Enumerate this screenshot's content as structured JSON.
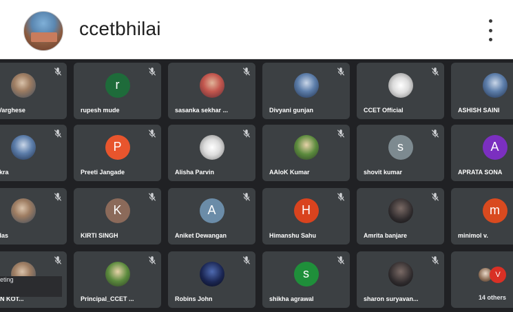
{
  "header": {
    "title": "ccetbhilai"
  },
  "tiles": [
    {
      "name": "P S Varghese",
      "initial": "",
      "color": ""
    },
    {
      "name": "rupesh mude",
      "initial": "r",
      "color": "#1e6b3a"
    },
    {
      "name": "sasanka sekhar ...",
      "initial": "",
      "color": ""
    },
    {
      "name": "Divyani gunjan",
      "initial": "",
      "color": ""
    },
    {
      "name": "CCET Official",
      "initial": "",
      "color": ""
    },
    {
      "name": "ASHISH SAINI",
      "initial": "",
      "color": ""
    },
    {
      "name": "Painkra",
      "initial": "",
      "color": ""
    },
    {
      "name": "Preeti Jangade",
      "initial": "P",
      "color": "#e8552d"
    },
    {
      "name": "Alisha Parvin",
      "initial": "",
      "color": ""
    },
    {
      "name": "AAloK Kumar",
      "initial": "",
      "color": ""
    },
    {
      "name": "shovit kumar",
      "initial": "s",
      "color": "#7d8a90"
    },
    {
      "name": "APRATA SONA",
      "initial": "A",
      "color": "#7b2fc0"
    },
    {
      "name": "Devdas",
      "initial": "",
      "color": ""
    },
    {
      "name": "KIRTI SINGH",
      "initial": "K",
      "color": "#8b6a5a"
    },
    {
      "name": "Aniket Dewangan",
      "initial": "A",
      "color": "#6b8ca8"
    },
    {
      "name": "Himanshu Sahu",
      "initial": "H",
      "color": "#d9431e"
    },
    {
      "name": "Amrita banjare",
      "initial": "",
      "color": ""
    },
    {
      "name": "minimol v.",
      "initial": "m",
      "color": "#d94a1f"
    },
    {
      "name": "EMAN KOT...",
      "initial": "",
      "color": ""
    },
    {
      "name": "Principal_CCET ...",
      "initial": "",
      "color": ""
    },
    {
      "name": "Robins John",
      "initial": "",
      "color": ""
    },
    {
      "name": "shikha agrawal",
      "initial": "s",
      "color": "#1f8f3a"
    },
    {
      "name": "sharon suryavan...",
      "initial": "",
      "color": ""
    }
  ],
  "overlay_text": "eting",
  "others": {
    "count_label": "14 others",
    "badge_letter": "V"
  },
  "icons": {
    "mic_off": "mic-off-icon",
    "menu": "more-vert-icon"
  }
}
